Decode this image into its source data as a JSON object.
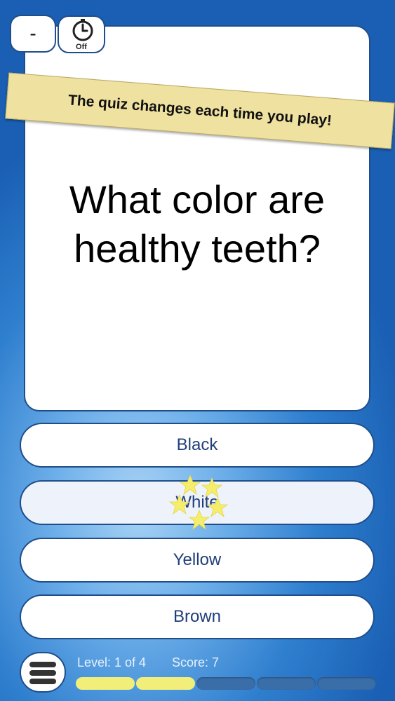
{
  "top_bar": {
    "minus_label": "-",
    "timer_label": "Off"
  },
  "banner": {
    "text": "The quiz changes each time you play!"
  },
  "question": {
    "text": "What color are healthy teeth?"
  },
  "answers": [
    {
      "label": "Black"
    },
    {
      "label": "White"
    },
    {
      "label": "Yellow"
    },
    {
      "label": "Brown"
    }
  ],
  "status": {
    "level_text": "Level: 1 of 4",
    "score_text": "Score: 7"
  },
  "progress": {
    "filled": 2,
    "total": 5
  },
  "colors": {
    "border": "#1f4e8a",
    "banner": "#efe1a0",
    "progress_on": "#f2ee7a",
    "progress_off": "#3a6ea8",
    "star": "#f6ee6a"
  },
  "icons": {
    "timer": "stopwatch-icon",
    "menu": "hamburger-menu-icon",
    "effect": "sparkle-stars-icon"
  }
}
